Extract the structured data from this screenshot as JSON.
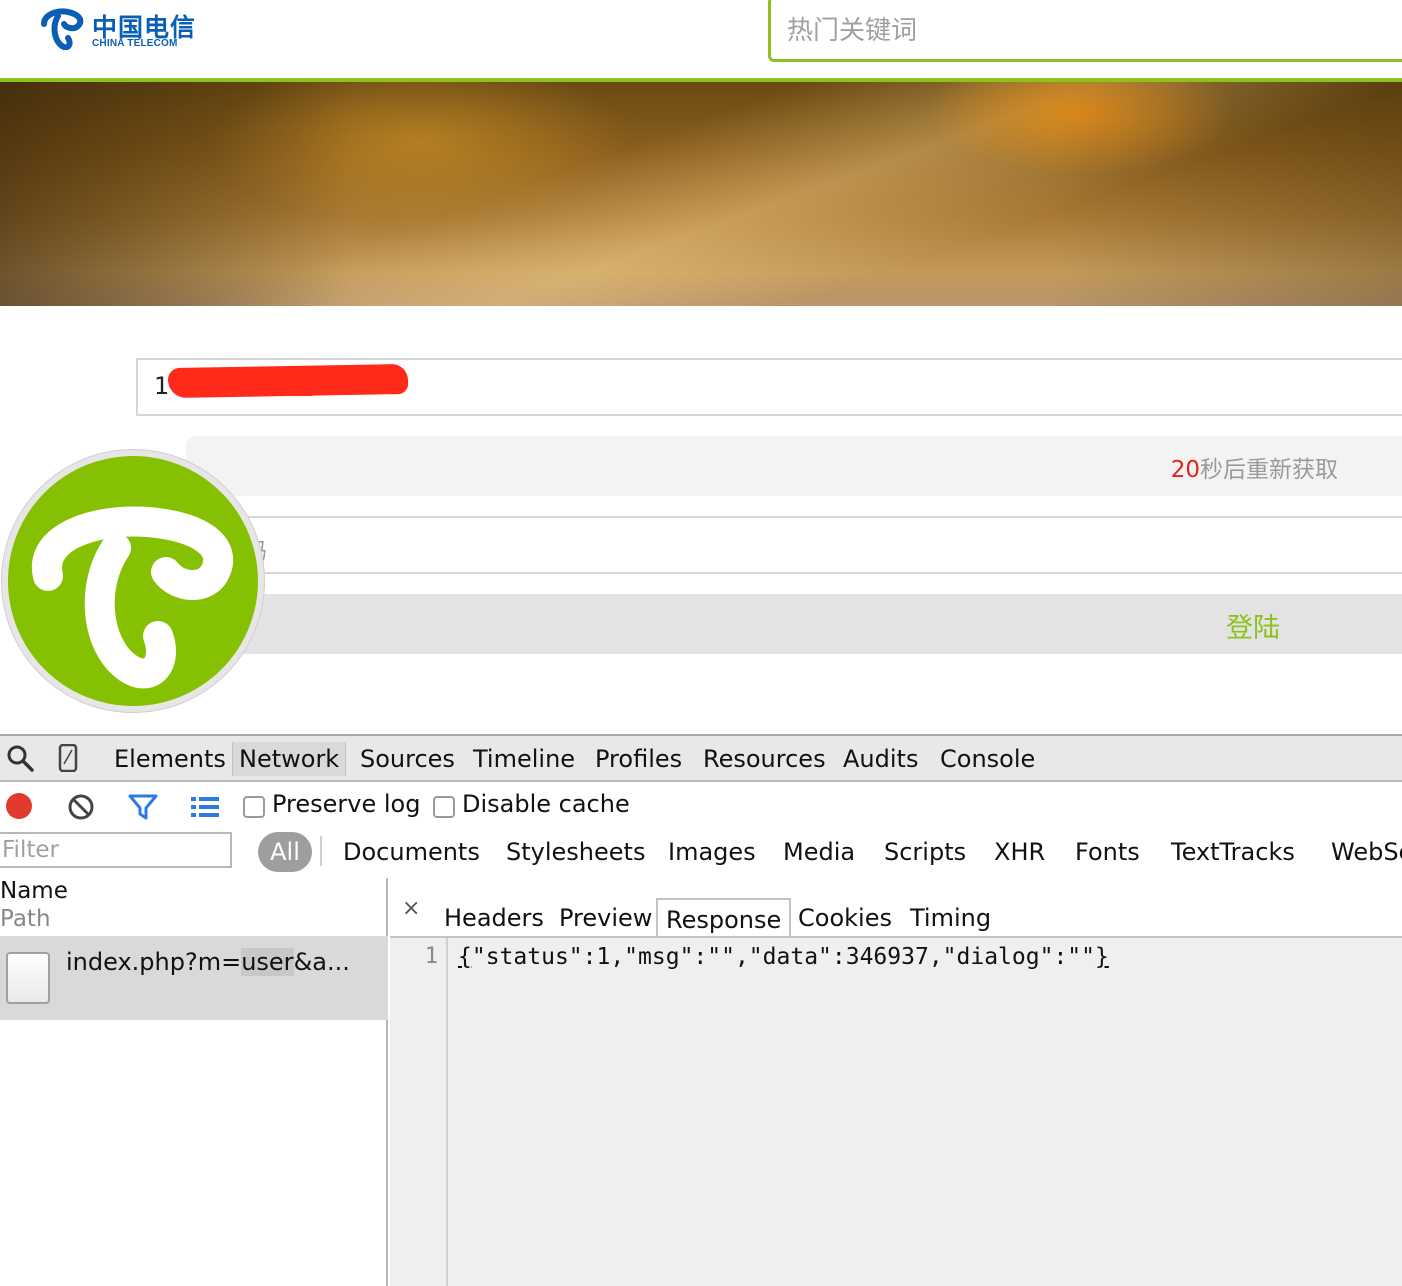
{
  "header": {
    "logo_cn": "中国电信",
    "logo_en": "CHINA TELECOM",
    "search_placeholder": "热门关键词",
    "accent_color": "#8cc11e",
    "brand_color": "#0a5fb4"
  },
  "login": {
    "phone_value": "1",
    "countdown_number": "20",
    "countdown_text": "秒后重新获取",
    "password_placeholder_visible": "码",
    "login_button": "登陆"
  },
  "devtools": {
    "main_tabs": [
      "Elements",
      "Network",
      "Sources",
      "Timeline",
      "Profiles",
      "Resources",
      "Audits",
      "Console"
    ],
    "active_tab": "Network",
    "toolbar": {
      "preserve_log": "Preserve log",
      "disable_cache": "Disable cache"
    },
    "filter_placeholder": "Filter",
    "resource_types": [
      "All",
      "Documents",
      "Stylesheets",
      "Images",
      "Media",
      "Scripts",
      "XHR",
      "Fonts",
      "TextTracks",
      "WebSc"
    ],
    "requests": {
      "col_name": "Name",
      "col_path": "Path",
      "row_prefix": "index.php?m=",
      "row_highlight": "user",
      "row_suffix": "&a..."
    },
    "detail": {
      "close": "×",
      "tabs": [
        "Headers",
        "Preview",
        "Response",
        "Cookies",
        "Timing"
      ],
      "active_tab": "Response",
      "line_number": "1",
      "response_open": "{",
      "response_middle": "\"status\":1,\"msg\":\"\",\"data\":346937,\"dialog\":\"\"",
      "response_close": "}"
    }
  }
}
